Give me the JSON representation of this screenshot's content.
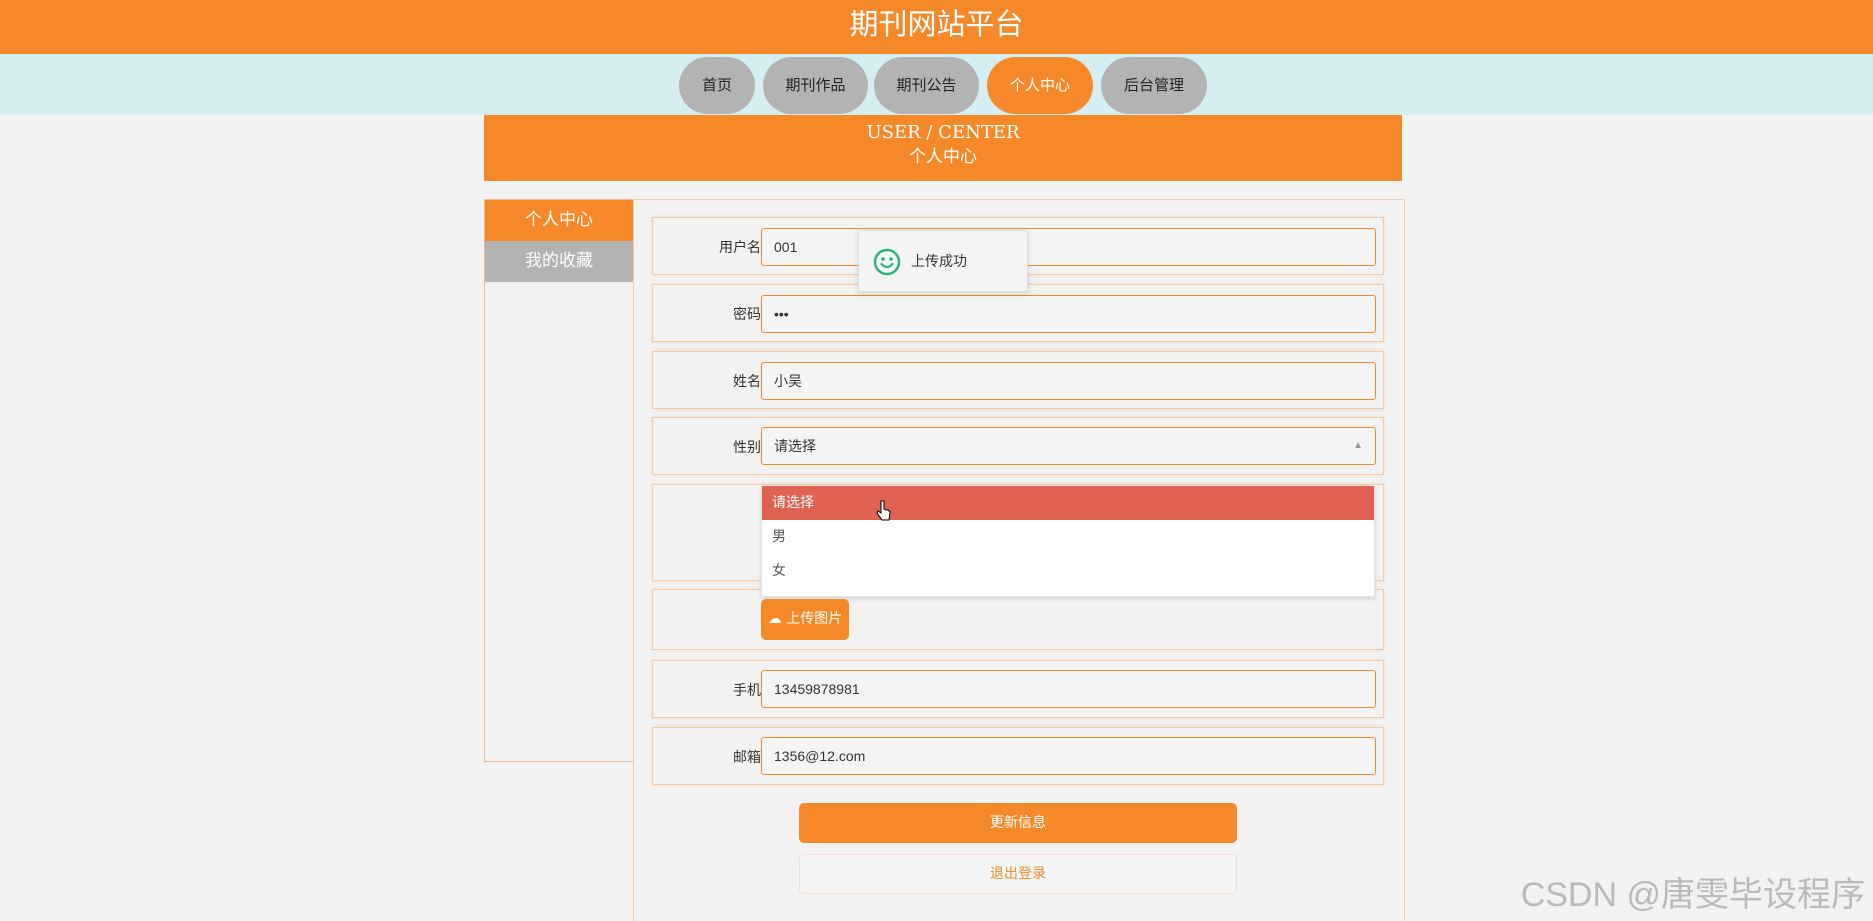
{
  "site": {
    "title": "期刊网站平台"
  },
  "nav": [
    {
      "label": "首页"
    },
    {
      "label": "期刊作品"
    },
    {
      "label": "期刊公告"
    },
    {
      "label": "个人中心"
    },
    {
      "label": "后台管理"
    }
  ],
  "banner": {
    "en": "USER / CENTER",
    "cn": "个人中心"
  },
  "sidebar": {
    "items": [
      {
        "label": "个人中心"
      },
      {
        "label": "我的收藏"
      }
    ]
  },
  "form": {
    "username": {
      "label": "用户名",
      "value": "001"
    },
    "password": {
      "label": "密码",
      "value": "•••"
    },
    "name": {
      "label": "姓名",
      "value": "小吴"
    },
    "gender": {
      "label": "性别",
      "value": "请选择",
      "options": [
        "请选择",
        "男",
        "女"
      ]
    },
    "upload_label": "上传图片",
    "phone": {
      "label": "手机",
      "value": "13459878981"
    },
    "email": {
      "label": "邮箱",
      "value": "1356@12.com"
    }
  },
  "toast": {
    "text": "上传成功"
  },
  "buttons": {
    "update": "更新信息",
    "logout": "退出登录"
  },
  "watermark": "CSDN @唐雯毕设程序",
  "colors": {
    "accent": "#f5892a",
    "nav_bg": "#d4eef2",
    "inactive": "#b3b3b3",
    "selected_option": "#e06152",
    "success": "#2ab37b"
  }
}
